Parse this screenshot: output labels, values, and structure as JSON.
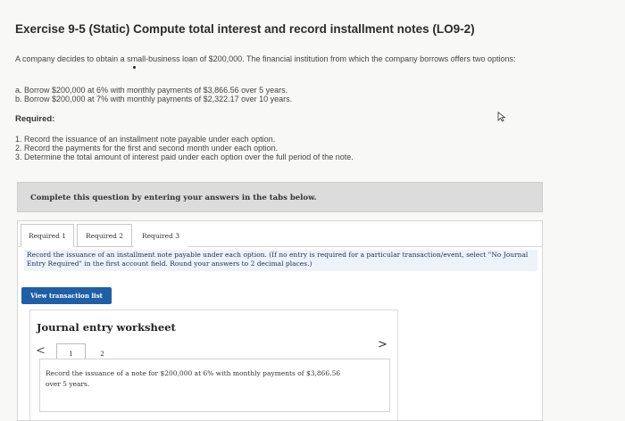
{
  "title": "Exercise 9-5 (Static) Compute total interest and record installment notes (LO9-2)",
  "intro": "A company decides to obtain a small-business loan of $200,000. The financial institution from which the company borrows offers two options:",
  "options": [
    "a. Borrow $200,000 at 6% with monthly payments of $3,866.56 over 5 years.",
    "b. Borrow $200,000 at 7% with monthly payments of $2,322.17 over 10 years."
  ],
  "required_heading": "Required:",
  "requirements": [
    "1. Record the issuance of an installment note payable under each option.",
    "2. Record the payments for the first and second month under each option.",
    "3. Determine the total amount of interest paid under each option over the full period of the note."
  ],
  "banner": "Complete this question by entering your answers in the tabs below.",
  "tabs": [
    "Required 1",
    "Required 2",
    "Required 3"
  ],
  "instruction": "Record the issuance of an installment note payable under each option. (If no entry is required for a particular transaction/event, select \"No Journal Entry Required\" in the first account field. Round your answers to 2 decimal places.)",
  "view_button": "View transaction list",
  "worksheet": {
    "title": "Journal entry worksheet",
    "nav_prev": "<",
    "nav_next": ">",
    "pages": [
      "1",
      "2"
    ],
    "description": "Record the issuance of a note for $200,000 at 6% with monthly payments of $3,866.56 over 5 years."
  },
  "colors": {
    "button": "#1f5fa8",
    "instruction_bg": "#eef3fb",
    "banner_bg": "#dcdcdc"
  }
}
